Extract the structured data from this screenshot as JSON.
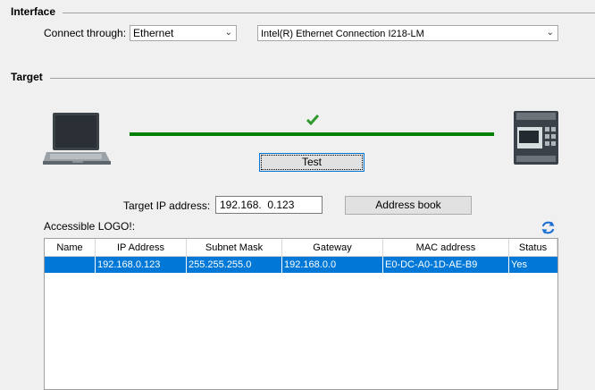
{
  "interface": {
    "title": "Interface",
    "connect_label": "Connect through:",
    "connection_type": "Ethernet",
    "adapter": "Intel(R) Ethernet Connection I218-LM"
  },
  "target": {
    "title": "Target",
    "test_button": "Test",
    "ip_label": "Target IP address:",
    "ip_value": "192.168.  0.123",
    "address_book_button": "Address book"
  },
  "accessible": {
    "label": "Accessible LOGO!:",
    "columns": [
      "Name",
      "IP Address",
      "Subnet Mask",
      "Gateway",
      "MAC address",
      "Status"
    ],
    "rows": [
      {
        "name": "",
        "ip": "192.168.0.123",
        "mask": "255.255.255.0",
        "gateway": "192.168.0.0",
        "mac": "E0-DC-A0-1D-AE-B9",
        "status": "Yes"
      }
    ]
  },
  "colors": {
    "link_line": "#008000",
    "check": "#2e9a2e",
    "selection": "#0078d7",
    "refresh": "#1a6fd1"
  },
  "icons": {
    "pc": "laptop-icon",
    "device": "logo-module-icon",
    "ok": "checkmark-icon",
    "refresh": "refresh-icon"
  }
}
